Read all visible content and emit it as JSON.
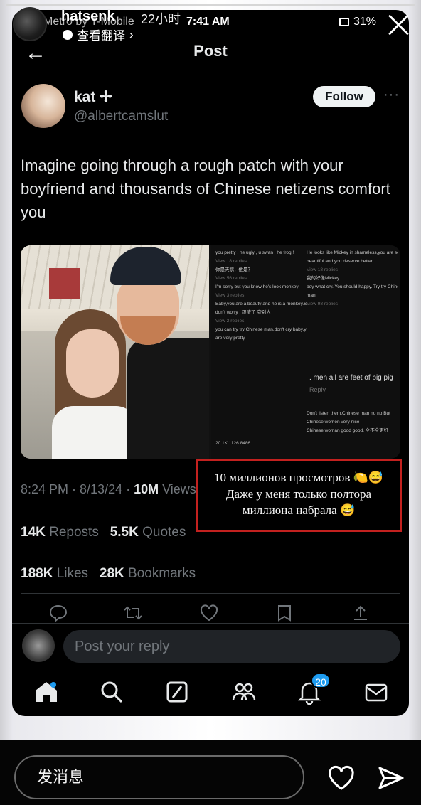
{
  "story": {
    "username": "hatsenk",
    "time": "22小时",
    "translate": "查看翻译",
    "message_placeholder": "发消息"
  },
  "status_bar": {
    "carrier": "Metro by T-Mobile",
    "time": "7:41 AM",
    "battery": "31%"
  },
  "header": {
    "title": "Post"
  },
  "author": {
    "name": "kat ✢",
    "handle": "@albertcamslut",
    "follow_label": "Follow"
  },
  "tweet": {
    "text": "Imagine going through a rough patch with your boyfriend and thousands of Chinese netizens comfort you"
  },
  "screenshot_comments": {
    "left": [
      "you pretty , he ugly , u swan , he frog !",
      "View 18 replies",
      "你是天鹅，他是？",
      "View 56 replies",
      "I'm sorry but you know   he's look monkey",
      "View 3 replies",
      "Baby,you are a beauty and he is a monkey.So",
      "don't worry ! 跟渣了 夸别人",
      "View 2 replies",
      "you can try try Chinese man,don't cry baby,you",
      "are  very pretty"
    ],
    "right": [
      "He looks like Mickey in shameless,you are so",
      "beautiful and you deserve better",
      "View 18 replies",
      "我的好像Mickey",
      "boy what cry. You should happy. Try try Chinese",
      "man",
      "View 98 replies",
      "Don't listen them,Chinese man no no!But",
      "Chinese women very nice",
      "Chinese woman good good, 全不全更好"
    ],
    "highlight": ". men all are feet of big pig",
    "reply": "Reply",
    "stats": "20.1K    1126    8486"
  },
  "overlay": {
    "line1": "10 миллионов просмотров 🍋😅",
    "line2": "Даже у меня только полтора",
    "line3": "миллиона набрала 😅"
  },
  "meta": {
    "time": "8:24 PM · 8/13/24 · ",
    "views_count": "10M",
    "views_label": " Views"
  },
  "engagement": {
    "reposts_count": "14K",
    "reposts_label": " Reposts",
    "quotes_count": "5.5K",
    "quotes_label": " Quotes",
    "likes_count": "188K",
    "likes_label": " Likes",
    "bookmarks_count": "28K",
    "bookmarks_label": " Bookmarks"
  },
  "reply": {
    "placeholder": "Post your reply"
  },
  "nav": {
    "notifications_badge": "20"
  },
  "colors": {
    "accent": "#1d9bf0",
    "annotation_border": "#c3211f",
    "background": "#000000",
    "muted": "#71767b"
  }
}
